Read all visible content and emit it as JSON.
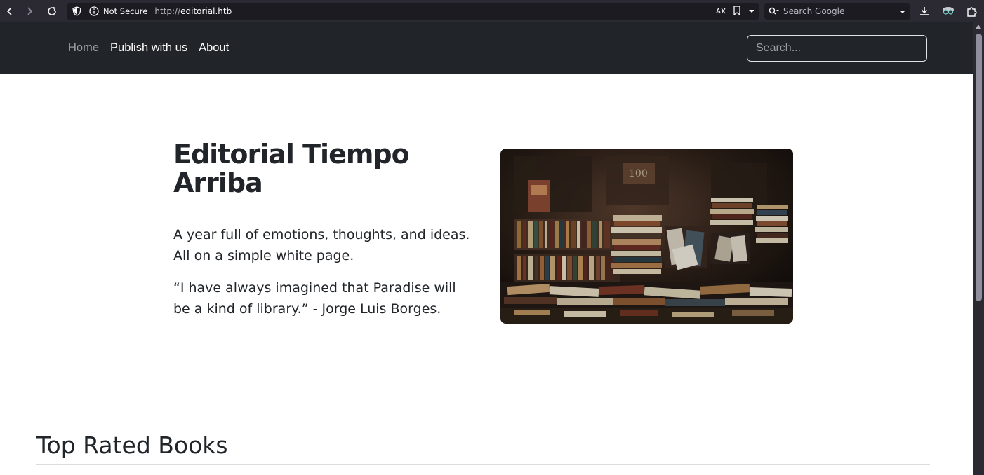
{
  "browser": {
    "security_label": "Not Secure",
    "url_scheme": "http://",
    "url_host": "editorial.htb",
    "search_placeholder": "Search Google"
  },
  "site_nav": {
    "links": [
      {
        "label": "Home",
        "active": true
      },
      {
        "label": "Publish with us",
        "active": false
      },
      {
        "label": "About",
        "active": false
      }
    ],
    "search_placeholder": "Search..."
  },
  "hero": {
    "title": "Editorial Tiempo Arriba",
    "lead": "A year full of emotions, thoughts, and ideas. All on a simple white page.",
    "quote": "“I have always imagined that Paradise will be a kind of library.” - Jorge Luis Borges.",
    "image_icon": "bookstore-photo"
  },
  "section": {
    "title": "Top Rated Books"
  },
  "colors": {
    "navbar_bg": "#212529",
    "browser_bg": "#2b2a33",
    "text": "#212529"
  }
}
